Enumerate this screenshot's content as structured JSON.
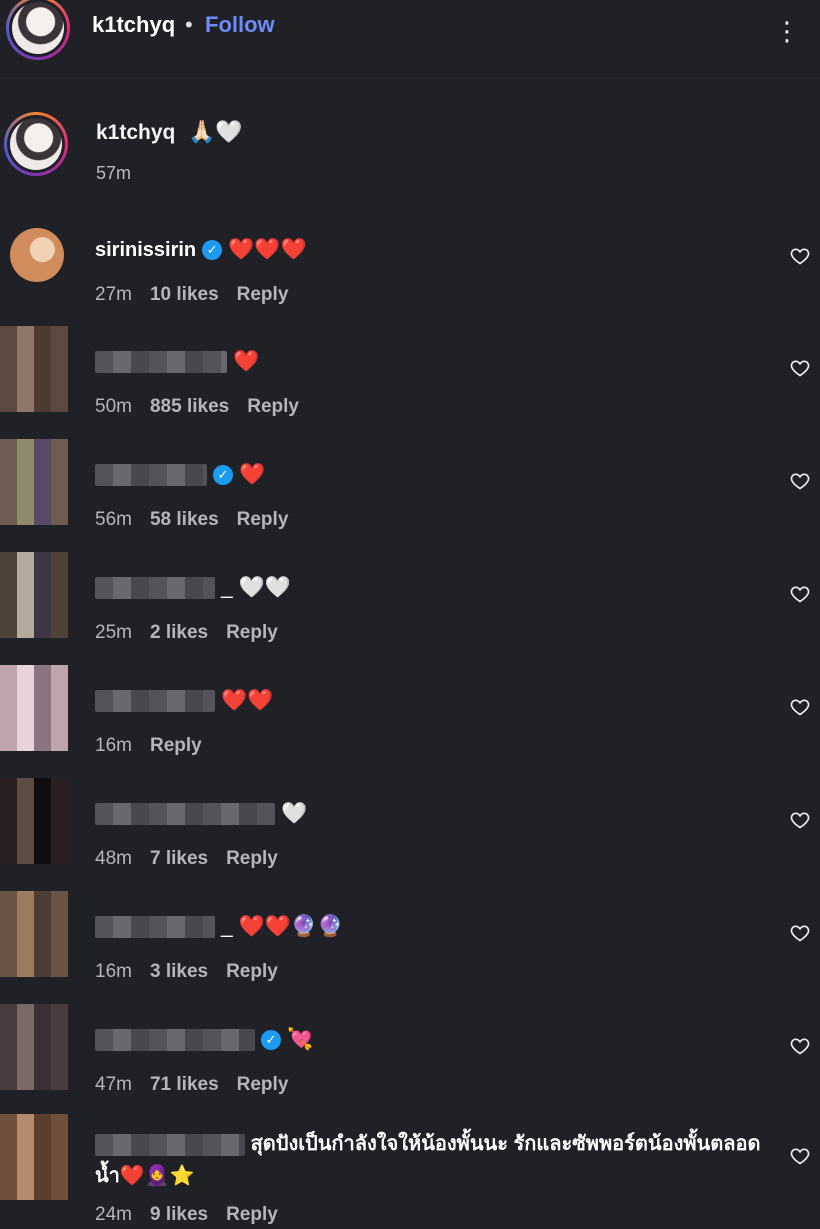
{
  "header": {
    "username": "k1tchyq",
    "separator": "•",
    "follow_label": "Follow",
    "more_label": "⋮"
  },
  "caption": {
    "username": "k1tchyq",
    "emoji": "🙏🏻🤍",
    "time": "57m"
  },
  "comments": [
    {
      "username": "sirinissirin",
      "text": "❤️❤️❤️",
      "time": "27m",
      "likes": "10 likes",
      "reply": "Reply"
    },
    {
      "text": "❤️",
      "time": "50m",
      "likes": "885 likes",
      "reply": "Reply"
    },
    {
      "text": "❤️",
      "time": "56m",
      "likes": "58 likes",
      "reply": "Reply"
    },
    {
      "text": "_ 🤍🤍",
      "time": "25m",
      "likes": "2 likes",
      "reply": "Reply"
    },
    {
      "text": "❤️❤️",
      "time": "16m",
      "likes": "",
      "reply": "Reply"
    },
    {
      "text": "🤍",
      "time": "48m",
      "likes": "7 likes",
      "reply": "Reply"
    },
    {
      "text": "_ ❤️❤️🔮🔮",
      "time": "16m",
      "likes": "3 likes",
      "reply": "Reply"
    },
    {
      "text": "💘",
      "time": "47m",
      "likes": "71 likes",
      "reply": "Reply"
    },
    {
      "text": "สุดปังเป็นกำลังใจให้น้องพั้นนะ รักและซัพพอร์ตน้องพั้นตลอดน้ำ❤️🧕⭐",
      "time": "24m",
      "likes": "9 likes",
      "reply": "Reply"
    }
  ],
  "colors": {
    "background": "#202027",
    "follow": "#6e8cf5",
    "verified": "#1d9bf0"
  }
}
